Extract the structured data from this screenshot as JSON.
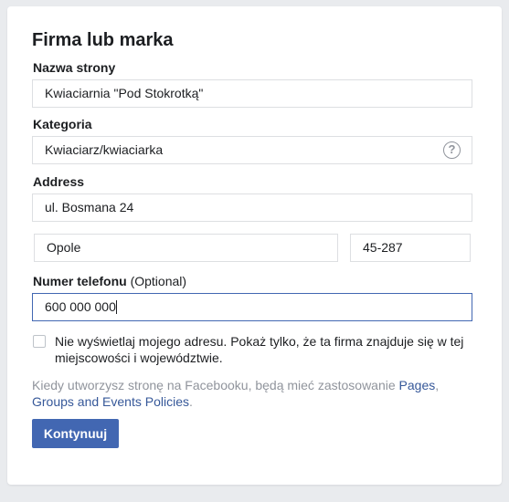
{
  "form": {
    "title": "Firma lub marka",
    "page_name": {
      "label": "Nazwa strony",
      "value": "Kwiaciarnia \"Pod Stokrotką\""
    },
    "category": {
      "label": "Kategoria",
      "value": "Kwiaciarz/kwiaciarka"
    },
    "address": {
      "label": "Address",
      "street": "ul. Bosmana 24",
      "city": "Opole",
      "postal_code": "45-287"
    },
    "phone": {
      "label": "Numer telefonu",
      "optional": "(Optional)",
      "value": "600 000 000"
    },
    "hide_address_checkbox": {
      "checked": false,
      "label": "Nie wyświetlaj mojego adresu. Pokaż tylko, że ta firma znajduje się w tej miejscowości i województwie."
    },
    "policy": {
      "prefix": "Kiedy utworzysz stronę na Facebooku, będą mieć zastosowanie ",
      "link1": "Pages",
      "sep": ", ",
      "link2": "Groups and Events Policies",
      "suffix": "."
    },
    "continue_label": "Kontynuuj"
  },
  "colors": {
    "background": "#e9ebee",
    "button": "#4267b2",
    "link": "#365899",
    "muted_text": "#90949c"
  },
  "icons": {
    "help": "question-circle"
  }
}
